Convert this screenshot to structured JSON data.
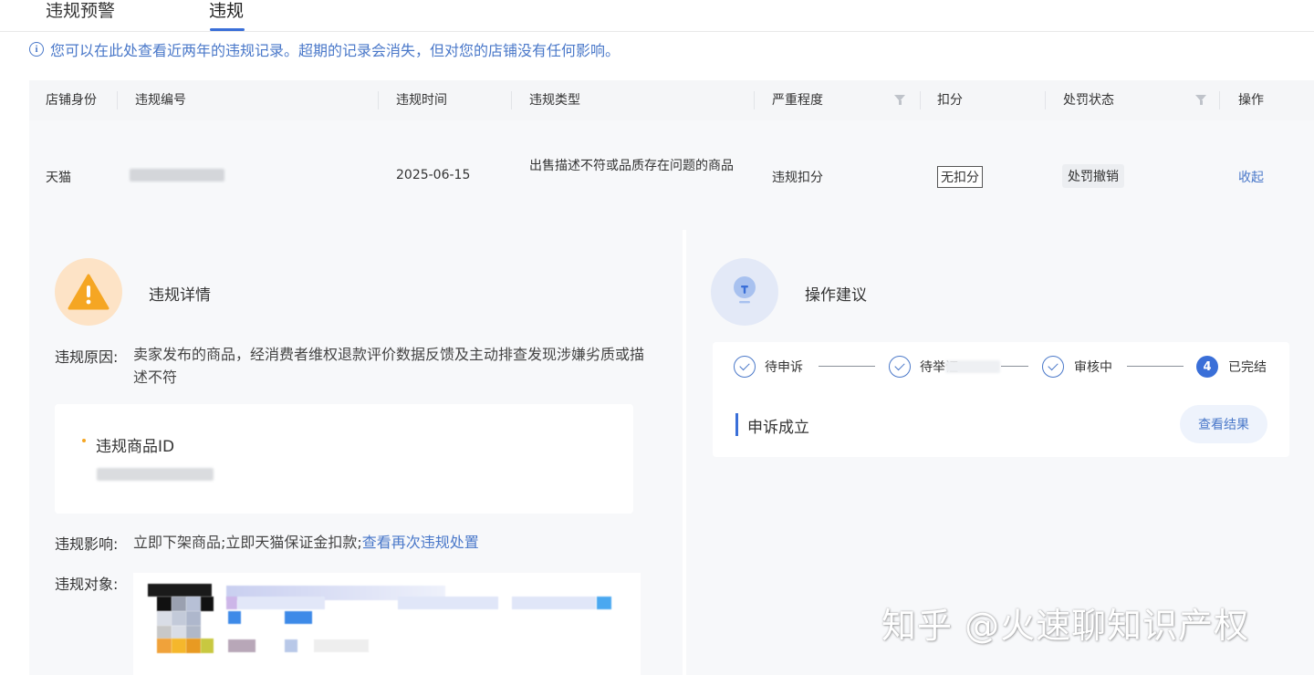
{
  "tabs": [
    {
      "label": "违规预警"
    },
    {
      "label": "违规",
      "active": true
    }
  ],
  "notice": {
    "icon": "info-icon",
    "text": "您可以在此处查看近两年的违规记录。超期的记录会消失，但对您的店铺没有任何影响。"
  },
  "table": {
    "headers": [
      "店铺身份",
      "违规编号",
      "违规时间",
      "违规类型",
      "严重程度",
      "扣分",
      "处罚状态",
      "操作"
    ],
    "row": {
      "shop_identity": "天猫",
      "violation_time": "2025-06-15",
      "violation_type": "出售描述不符或品质存在问题的商品",
      "severity": "违规扣分",
      "deduction": "无扣分",
      "penalty_status": "处罚撤销",
      "action": "收起"
    }
  },
  "detail": {
    "title": "违规详情",
    "reason_label": "违规原因:",
    "reason_text": "卖家发布的商品，经消费者维权退款评价数据反馈及主动排查发现涉嫌劣质或描述不符",
    "product_id_label": "违规商品ID",
    "impact_label": "违规影响:",
    "impact_text": "立即下架商品;立即天猫保证金扣款;",
    "impact_link": "查看再次违规处置",
    "object_label": "违规对象:"
  },
  "advice": {
    "title": "操作建议",
    "steps": [
      {
        "label": "待申诉",
        "done": true
      },
      {
        "label": "待举证",
        "done": true
      },
      {
        "label": "审核中",
        "done": true
      },
      {
        "label": "已完结",
        "number": "4",
        "current": true
      }
    ],
    "result_text": "申诉成立",
    "result_button": "查看结果"
  },
  "watermark": "知乎 @火速聊知识产权",
  "colors": {
    "accent": "#3a6fd8",
    "link": "#4a78c9",
    "warning": "#f5a623"
  }
}
